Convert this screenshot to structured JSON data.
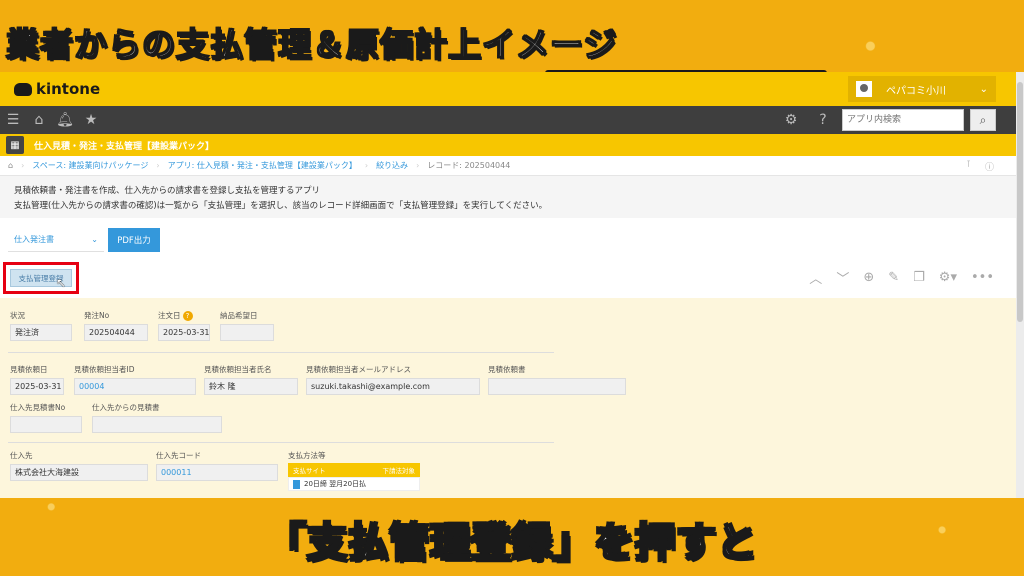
{
  "overlay": {
    "headline": "業者からの支払管理＆原価計上イメージ",
    "subtitle": "「支払管理登録」を押すと"
  },
  "header": {
    "logo": "kintone",
    "user_name": "ペパコミ小川",
    "search_placeholder": "アプリ内検索"
  },
  "app": {
    "title": "仕入見積・発注・支払管理【建設業パック】"
  },
  "breadcrumb": {
    "items": [
      "スペース: 建設業向けパッケージ",
      "アプリ: 仕入見積・発注・支払管理【建設業パック】",
      "絞り込み",
      "レコード: 202504044"
    ]
  },
  "description": {
    "line1": "見積依頼書・発注書を作成、仕入先からの請求書を登録し支払を管理するアプリ",
    "line2": "支払管理(仕入先からの請求書の確認)は一覧から「支払管理」を選択し、該当のレコード詳細画面で「支払管理登録」を実行してください。"
  },
  "controls": {
    "select_value": "仕入発注書",
    "pdf_button": "PDF出力",
    "pay_register_button": "支払管理登録"
  },
  "record": {
    "status_label": "状況",
    "status_value": "発注済",
    "order_no_label": "発注No",
    "order_no_value": "202504044",
    "order_date_label": "注文日",
    "order_date_value": "2025-03-31",
    "delivery_label": "納品希望日",
    "delivery_value": "",
    "quote_date_label": "見積依頼日",
    "quote_date_value": "2025-03-31",
    "quote_person_id_label": "見積依頼担当者ID",
    "quote_person_id_value": "00004",
    "quote_person_name_label": "見積依頼担当者氏名",
    "quote_person_name_value": "鈴木 隆",
    "quote_email_label": "見積依頼担当者メールアドレス",
    "quote_email_value": "suzuki.takashi@example.com",
    "quote_doc_label": "見積依頼書",
    "quote_doc_value": "",
    "supplier_quote_no_label": "仕入先見積書No",
    "supplier_quote_no_value": "",
    "supplier_quote_label": "仕入先からの見積書",
    "supplier_quote_value": "",
    "supplier_label": "仕入先",
    "supplier_value": "株式会社大海建設",
    "supplier_code_label": "仕入先コード",
    "supplier_code_value": "000011",
    "payment_method_label": "支払方法等",
    "payment_table": {
      "col1": "支払サイト",
      "col2": "下請法対象",
      "row1": "20日締 翌月20日払"
    }
  }
}
